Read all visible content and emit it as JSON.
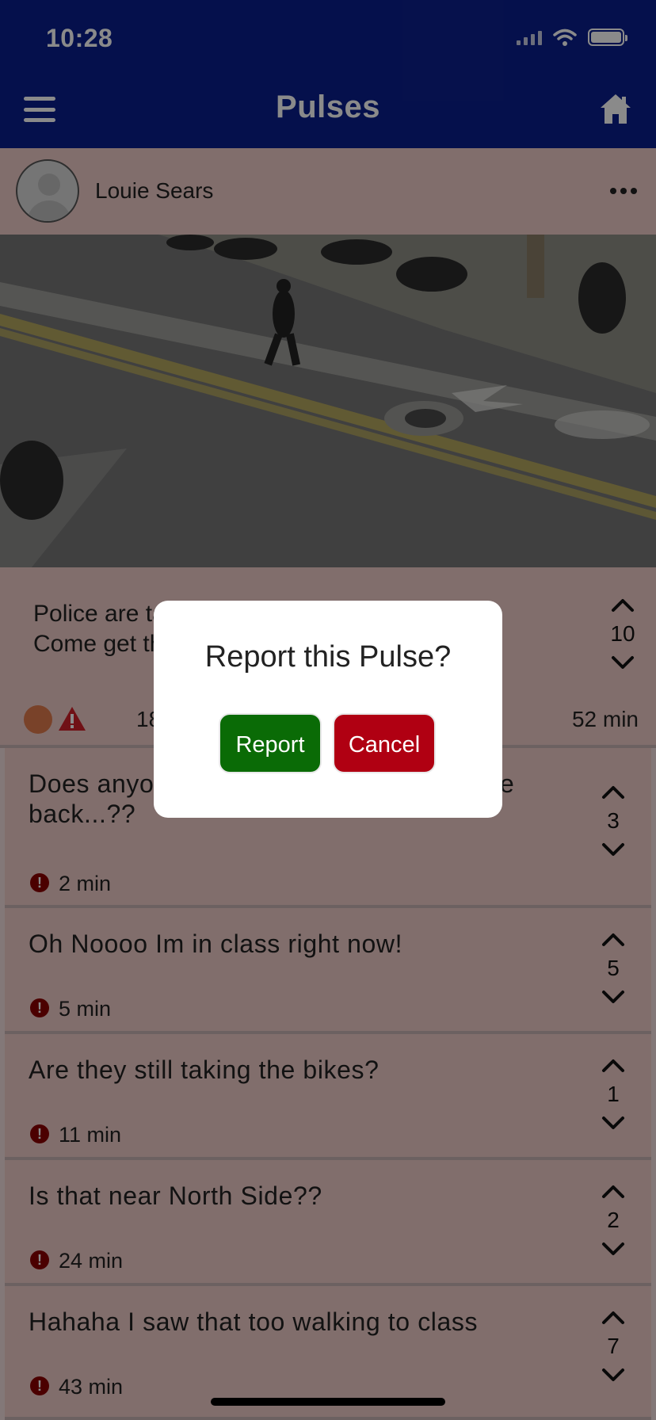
{
  "status": {
    "time": "10:28"
  },
  "nav": {
    "title": "Pulses"
  },
  "post": {
    "author": "Louie Sears",
    "text": "Police are taking motorcycles outside Haas! Come get them!",
    "votes": "10",
    "count": "18",
    "time": "52 min"
  },
  "comments": [
    {
      "text": "Does anyone know how I can get my bike back...??",
      "votes": "3",
      "time": "2 min"
    },
    {
      "text": "Oh Noooo Im in class right now!",
      "votes": "5",
      "time": "5 min"
    },
    {
      "text": "Are they still taking the bikes?",
      "votes": "1",
      "time": "11 min"
    },
    {
      "text": "Is that near North Side??",
      "votes": "2",
      "time": "24 min"
    },
    {
      "text": "Hahaha I saw that too walking to class",
      "votes": "7",
      "time": "43 min"
    }
  ],
  "modal": {
    "title": "Report this Pulse?",
    "report_label": "Report",
    "cancel_label": "Cancel"
  },
  "colors": {
    "nav_bg": "#0b1f8c",
    "post_bg": "#efcbc7",
    "report_button": "#0a6b06",
    "cancel_button": "#b00012"
  },
  "icons": {
    "menu": "hamburger-menu-icon",
    "home": "home-icon",
    "more": "more-horizontal-icon",
    "up": "chevron-up-icon",
    "down": "chevron-down-icon",
    "report": "exclamation-circle-icon",
    "warning": "warning-triangle-icon"
  }
}
